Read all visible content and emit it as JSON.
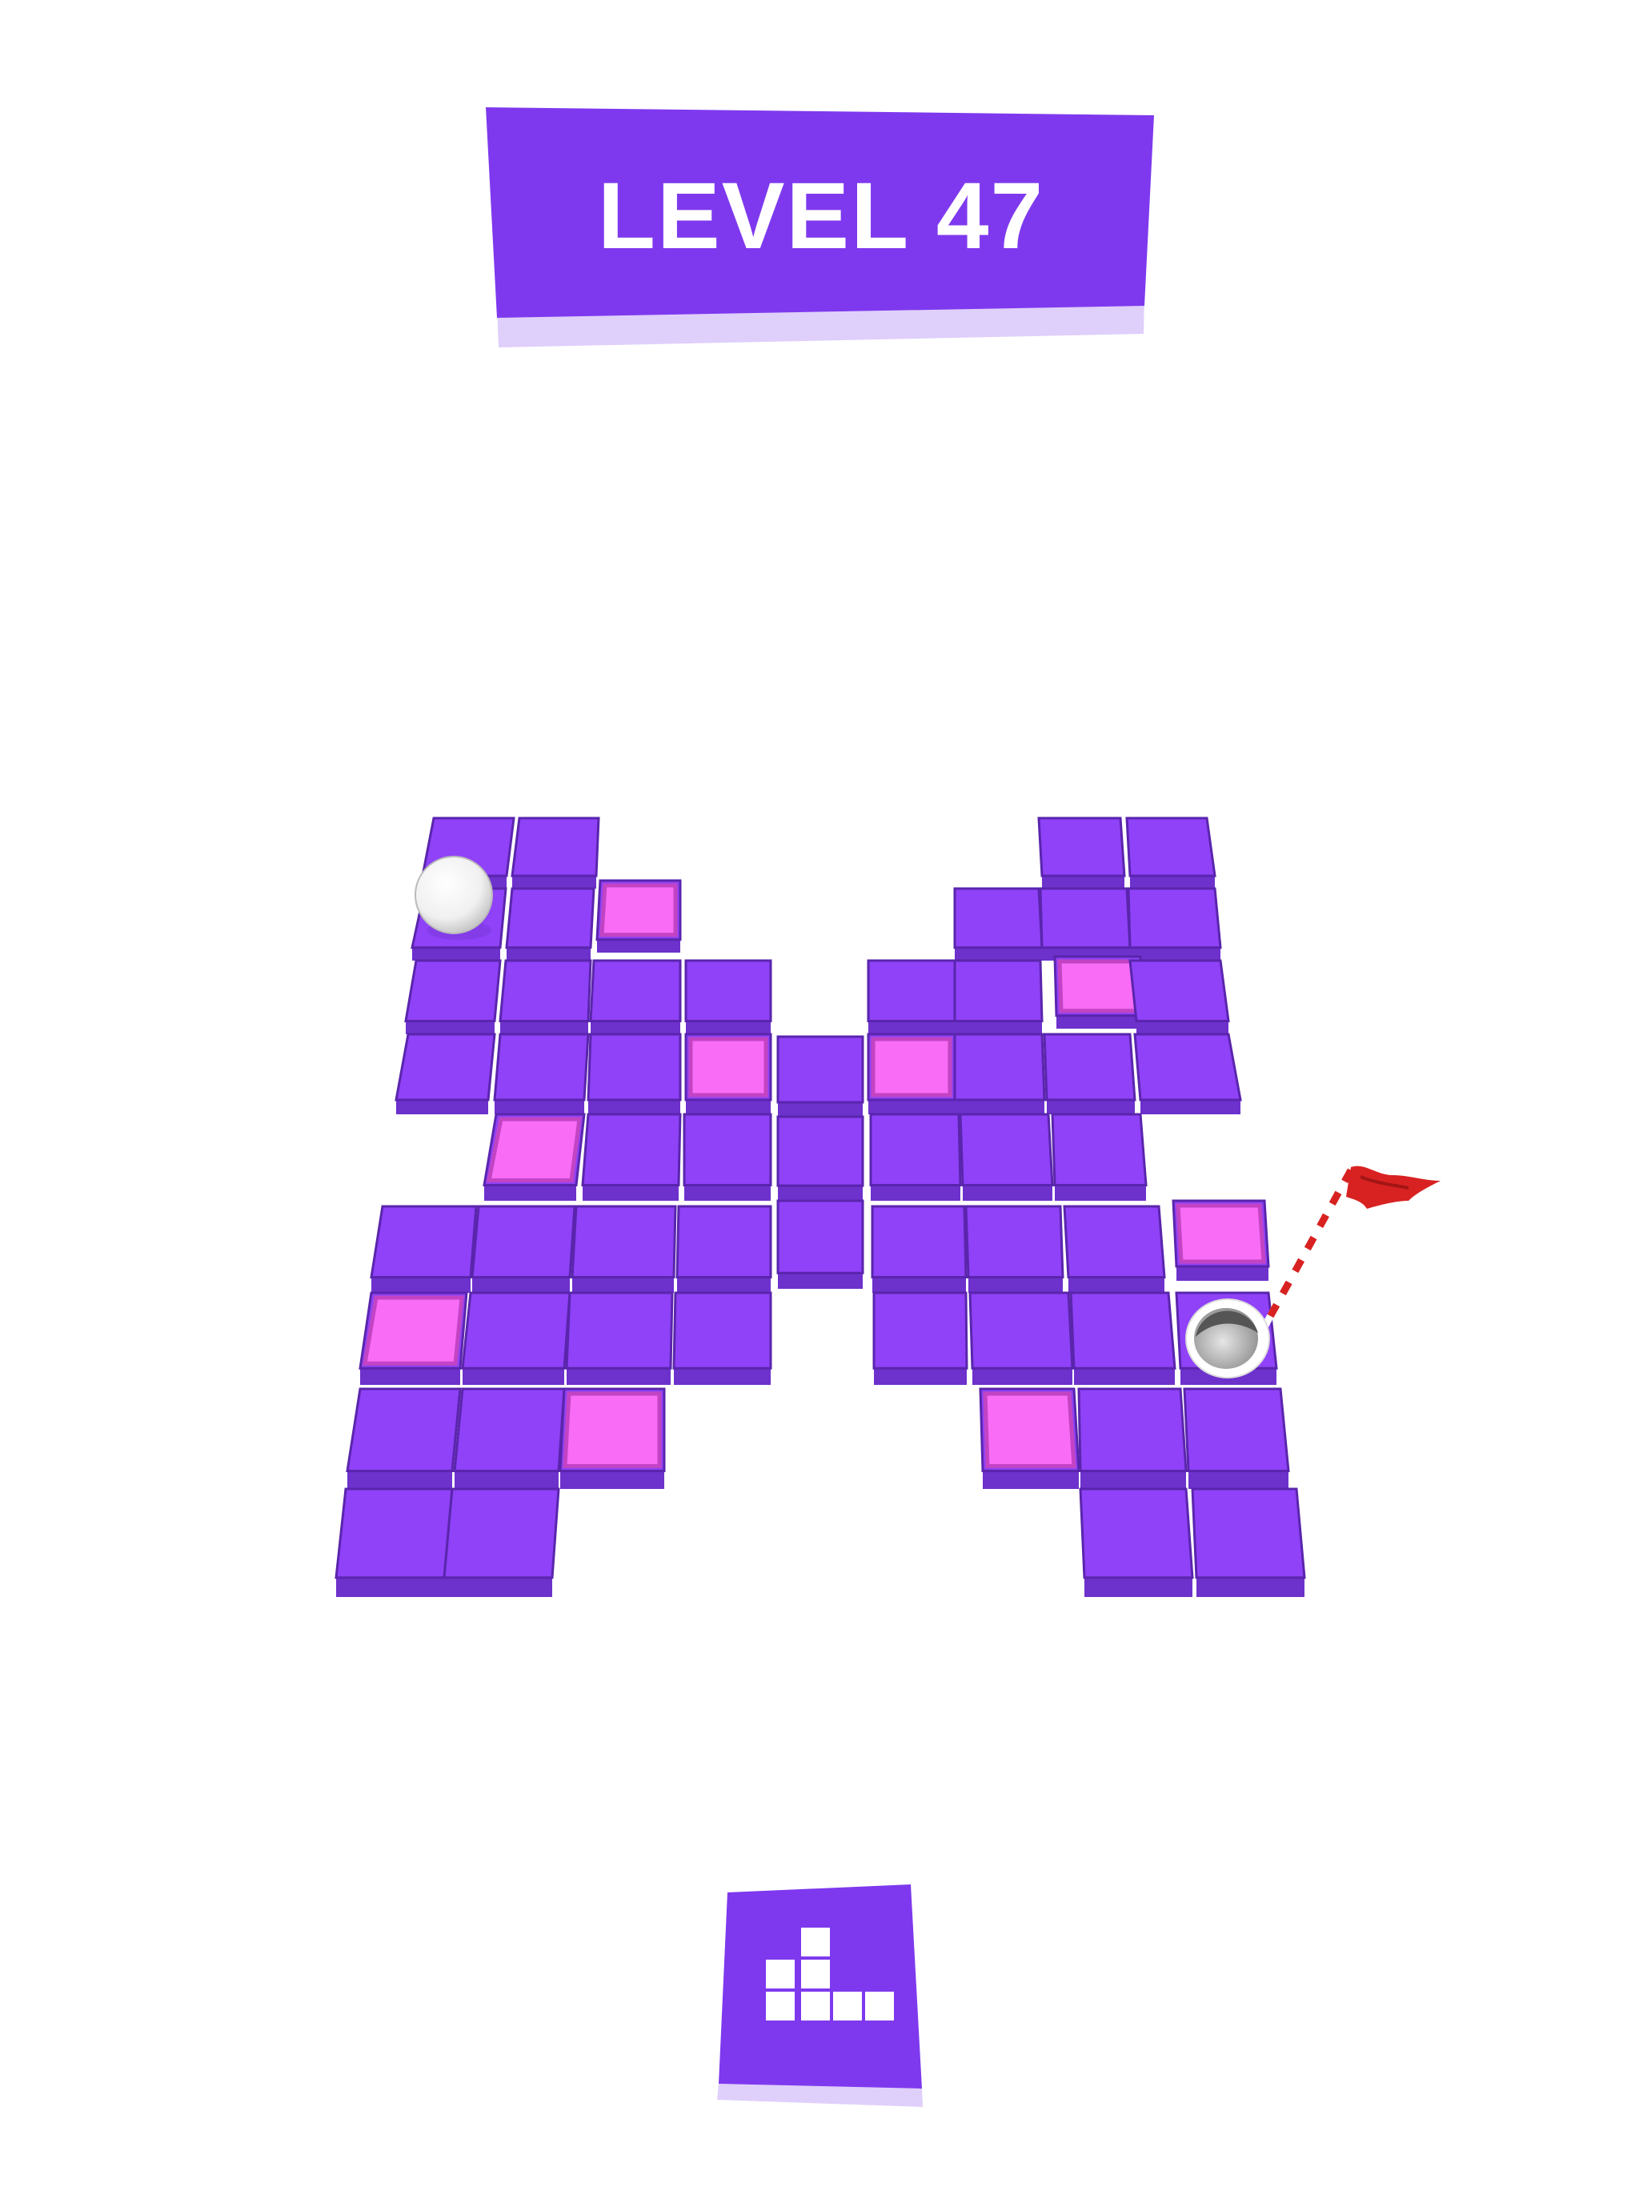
{
  "level": {
    "label": "LEVEL 47"
  },
  "colors": {
    "block_top": "#8f42f7",
    "block_side": "#6d31cc",
    "block_edge": "#5a25ad",
    "painted_top": "#f86cf6",
    "painted_edge": "#c244c4",
    "banner": "#7e39ee",
    "banner_shadow": "#dfcffb",
    "flag": "#d82222"
  },
  "icons": {
    "ball": "golf-ball-icon",
    "hole": "hole-icon",
    "flag": "flag-icon",
    "levels": "level-select-grid-icon"
  }
}
